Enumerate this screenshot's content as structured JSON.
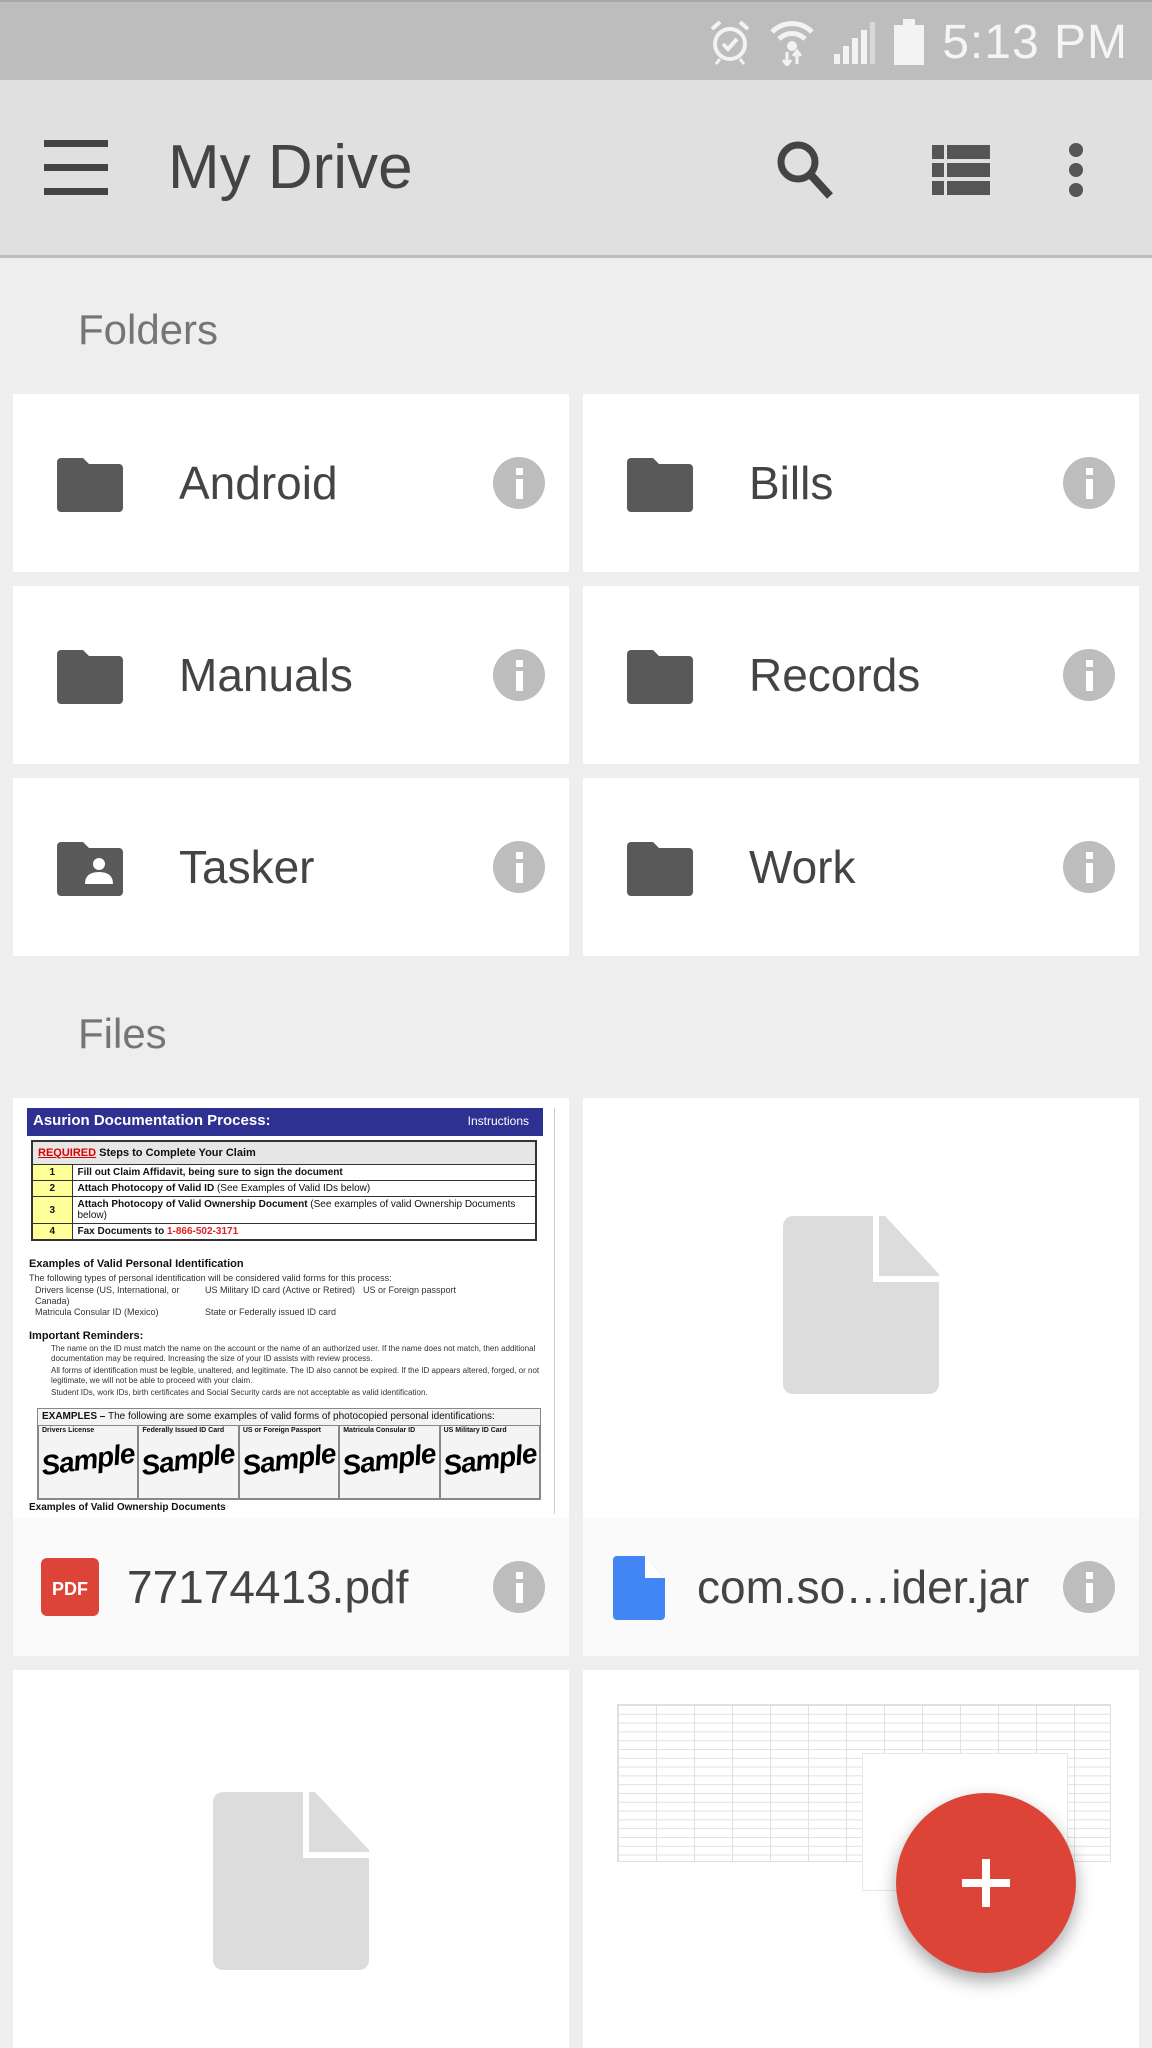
{
  "status_bar": {
    "time": "5:13 PM",
    "icons": [
      "alarm-icon",
      "wifi-icon",
      "signal-icon",
      "battery-icon"
    ]
  },
  "app_bar": {
    "title": "My Drive",
    "menu_icon": "hamburger-menu-icon",
    "actions": [
      "search-icon",
      "list-view-icon",
      "more-vert-icon"
    ]
  },
  "folders": {
    "label": "Folders",
    "items": [
      {
        "name": "Android",
        "icon": "folder-icon"
      },
      {
        "name": "Bills",
        "icon": "folder-icon"
      },
      {
        "name": "Manuals",
        "icon": "folder-icon"
      },
      {
        "name": "Records",
        "icon": "folder-icon"
      },
      {
        "name": "Tasker",
        "icon": "shared-folder-icon"
      },
      {
        "name": "Work",
        "icon": "folder-icon"
      }
    ]
  },
  "files": {
    "label": "Files",
    "items": [
      {
        "name": "77174413.pdf",
        "type_icon": "pdf-icon",
        "type_label": "PDF"
      },
      {
        "name": "com.so…ider.jar",
        "type_icon": "generic-file-icon"
      }
    ]
  },
  "pdf_preview": {
    "title": "Asurion Documentation Process:",
    "header_right": "Instructions",
    "required_word": "REQUIRED",
    "required_rest": " Steps to Complete Your Claim",
    "steps": [
      {
        "n": "1",
        "bold": "Fill out Claim Affidavit, being sure to sign the document",
        "rest": ""
      },
      {
        "n": "2",
        "bold": "Attach Photocopy of Valid ID",
        "rest": " (See Examples of Valid IDs below)"
      },
      {
        "n": "3",
        "bold": "Attach Photocopy of Valid Ownership Document",
        "rest": " (See examples of valid Ownership Documents below)"
      },
      {
        "n": "4",
        "bold": "Fax Documents to ",
        "phone": "1-866-502-3171"
      }
    ],
    "personal_id_heading": "Examples of Valid Personal Identification",
    "personal_id_intro": "The following types of personal identification will be considered valid forms for this process:",
    "id_types": [
      "Drivers license (US, International, or Canada)",
      "US Military ID card (Active or Retired)",
      "US or Foreign passport",
      "Matricula Consular ID (Mexico)",
      "State or Federally issued ID card"
    ],
    "reminders_heading": "Important Reminders:",
    "reminders": [
      "The name on the ID must match the name on the account or the name of an authorized user. If the name does not match, then additional documentation may be required. Increasing the size of your ID assists with review process.",
      "All forms of identification must be legible, unaltered, and legitimate. The ID also cannot be expired. If the ID appears altered, forged, or not legitimate, we will not be able to proceed with your claim.",
      "Student IDs, work IDs, birth certificates and Social Security cards are not acceptable as valid identification."
    ],
    "examples_heading_bold": "EXAMPLES –",
    "examples_heading_rest": " The following are some examples of valid forms of photocopied personal identifications:",
    "example_columns": [
      "Drivers License",
      "Federally Issued ID Card",
      "US or Foreign Passport",
      "Matricula Consular ID",
      "US Military ID Card"
    ],
    "sample_word": "Sample",
    "ownership_heading": "Examples of Valid Ownership Documents"
  },
  "fab": {
    "icon": "plus-icon",
    "color": "#db4437"
  },
  "colors": {
    "pdf_red": "#db4437",
    "file_blue": "#4285f4",
    "text_dark": "#444444",
    "info_gray": "#bdbdbd"
  }
}
